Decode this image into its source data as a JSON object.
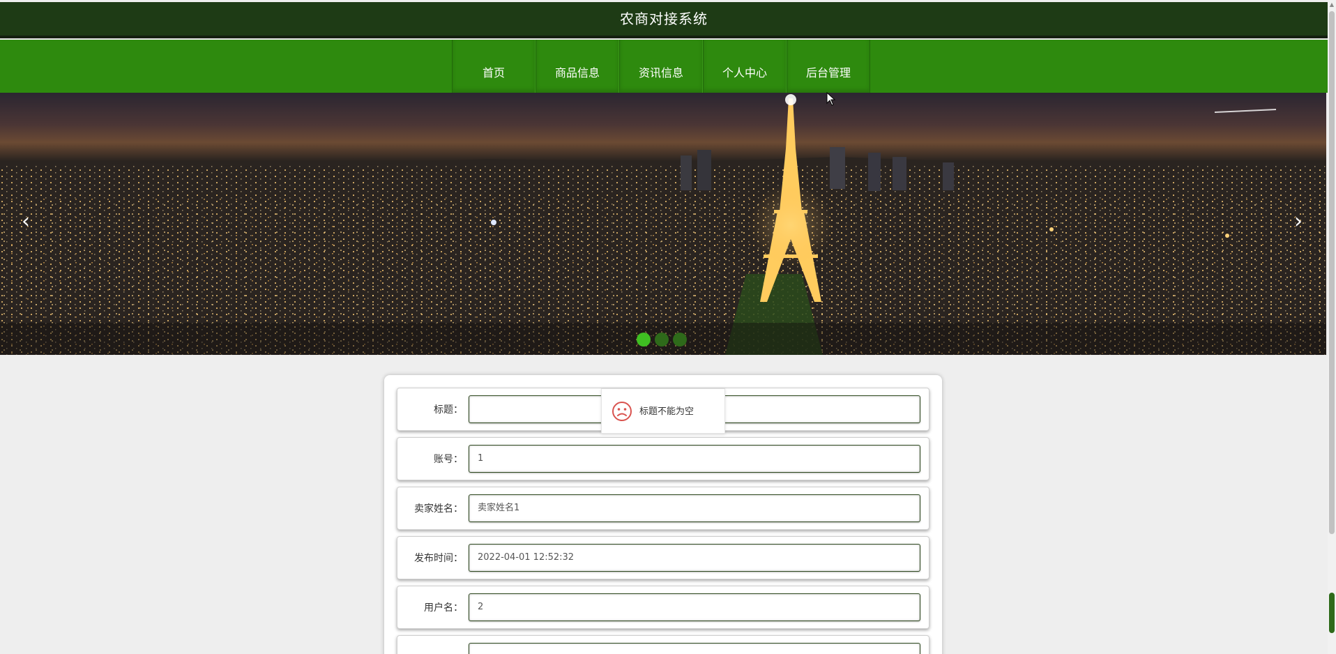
{
  "header": {
    "title": "农商对接系统"
  },
  "nav": {
    "items": [
      {
        "label": "首页"
      },
      {
        "label": "商品信息"
      },
      {
        "label": "资讯信息"
      },
      {
        "label": "个人中心"
      },
      {
        "label": "后台管理"
      }
    ]
  },
  "carousel": {
    "prev_icon": "chevron-left-icon",
    "next_icon": "chevron-right-icon",
    "prev_glyph": "‹",
    "next_glyph": "›",
    "slide_count": 3,
    "active_index": 0
  },
  "form": {
    "fields": [
      {
        "label": "标题：",
        "value": ""
      },
      {
        "label": "账号：",
        "value": "1"
      },
      {
        "label": "卖家姓名：",
        "value": "卖家姓名1"
      },
      {
        "label": "发布时间：",
        "value": "2022-04-01 12:52:32"
      },
      {
        "label": "用户名：",
        "value": "2"
      },
      {
        "label": "",
        "value": ""
      }
    ]
  },
  "toast": {
    "icon": "sad-face-icon",
    "message": "标题不能为空",
    "color": "#d9534f"
  },
  "colors": {
    "title_bar": "#1e3b15",
    "nav_bar": "#2e8a0e",
    "dot_active": "#3fbf22",
    "dot_inactive": "#2e6a1a"
  }
}
